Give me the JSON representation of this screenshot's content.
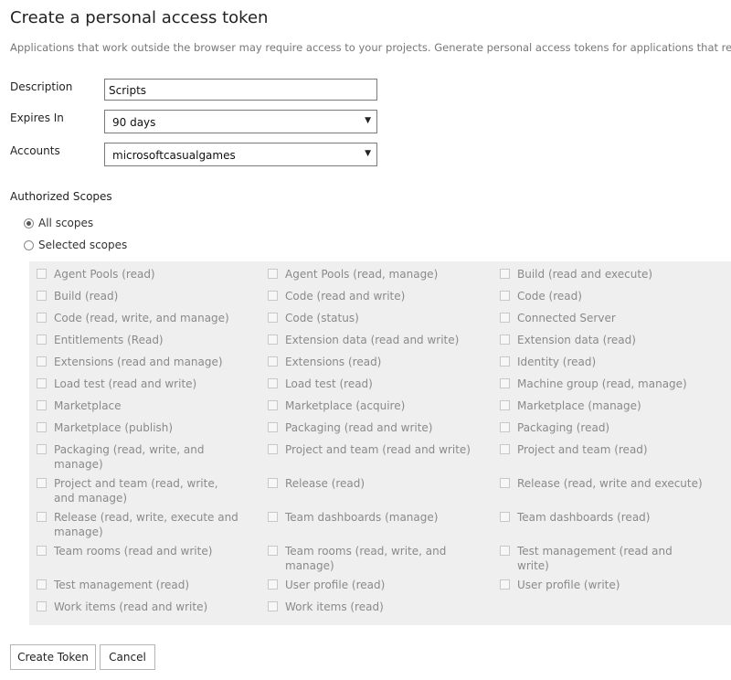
{
  "header": {
    "title": "Create a personal access token",
    "subtitle": "Applications that work outside the browser may require access to your projects. Generate personal access tokens for applications that require a userna"
  },
  "form": {
    "description_label": "Description",
    "description_value": "Scripts",
    "expires_label": "Expires In",
    "expires_value": "90 days",
    "accounts_label": "Accounts",
    "accounts_value": "microsoftcasualgames"
  },
  "scopes_section": {
    "label": "Authorized Scopes",
    "all_scopes": "All scopes",
    "selected_scopes": "Selected scopes",
    "selected_option": "All scopes"
  },
  "scopes": {
    "columns": [
      [
        "Agent Pools (read)",
        "Build (read)",
        "Code (read, write, and manage)",
        "Entitlements (Read)",
        "Extensions (read and manage)",
        "Load test (read and write)",
        "Marketplace",
        "Marketplace (publish)",
        "Packaging (read, write, and manage)",
        "Project and team (read, write, and manage)",
        "Release (read, write, execute and manage)",
        "Team rooms (read and write)",
        "Test management (read)",
        "Work items (read and write)"
      ],
      [
        "Agent Pools (read, manage)",
        "Code (read and write)",
        "Code (status)",
        "Extension data (read and write)",
        "Extensions (read)",
        "Load test (read)",
        "Marketplace (acquire)",
        "Packaging (read and write)",
        "Project and team (read and write)",
        "Release (read)",
        "Team dashboards (manage)",
        "Team rooms (read, write, and manage)",
        "User profile (read)",
        "Work items (read)"
      ],
      [
        "Build (read and execute)",
        "Code (read)",
        "Connected Server",
        "Extension data (read)",
        "Identity (read)",
        "Machine group (read, manage)",
        "Marketplace (manage)",
        "Packaging (read)",
        "Project and team (read)",
        "Release (read, write and execute)",
        "Team dashboards (read)",
        "Test management (read and write)",
        "User profile (write)"
      ]
    ]
  },
  "actions": {
    "create_label": "Create Token",
    "cancel_label": "Cancel"
  }
}
